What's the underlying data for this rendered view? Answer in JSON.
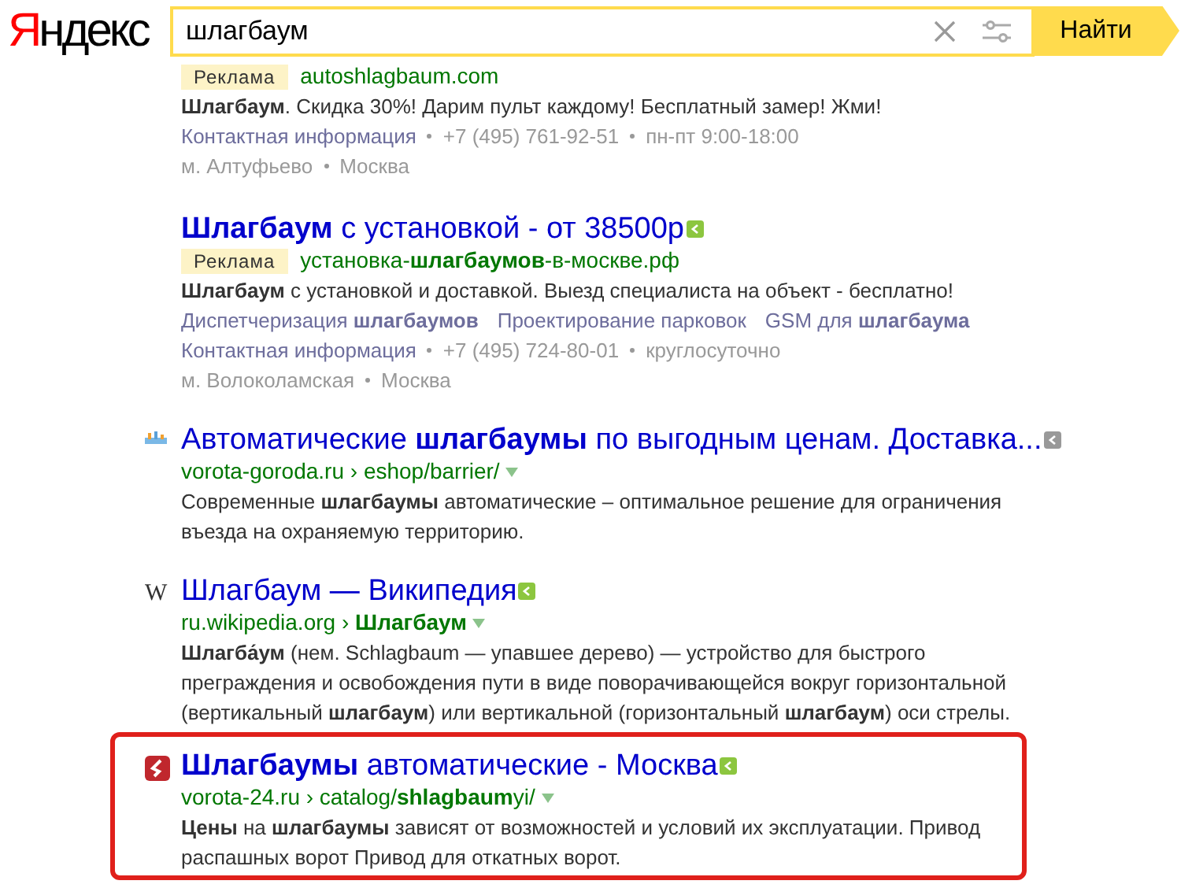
{
  "header": {
    "logo": "Яндекс",
    "query": "шлагбаум",
    "search_button": "Найти"
  },
  "results": [
    {
      "kind": "ad",
      "badge": "Реклама",
      "url": "autoshlagbaum.com",
      "text": "**Шлагбаум**. Скидка 30%! Дарим пульт каждому! Бесплатный замер! Жми!",
      "contacts": [
        "Контактная информация",
        "+7 (495) 761-92-51",
        "пн-пт 9:00-18:00"
      ],
      "metro": [
        "м. Алтуфьево",
        "Москва"
      ],
      "highlighted": false
    },
    {
      "kind": "ad",
      "title": "**Шлагбаум** с установкой - от 38500р",
      "title_mark": {
        "color": "#8cc63f"
      },
      "badge": "Реклама",
      "url": "установка-**шлагбаумов**-в-москве.рф",
      "text": "**Шлагбаум** с установкой и доставкой. Выезд специалиста на объект - бесплатно!",
      "sitelinks": [
        "Диспетчеризация **шлагбаумов**",
        "Проектирование парковок",
        "GSM для **шлагбаума**"
      ],
      "contacts": [
        "Контактная информация",
        "+7 (495) 724-80-01",
        "круглосуточно"
      ],
      "metro": [
        "м. Волоколамская",
        "Москва"
      ],
      "highlighted": false
    },
    {
      "kind": "organic",
      "favicon": {
        "kind": "bars"
      },
      "title": "Автоматические **шлагбаумы** по выгодным ценам. Доставка...",
      "title_mark": {
        "color": "#999999"
      },
      "url": "vorota-goroda.ru › eshop/barrier/",
      "text": "Современные **шлагбаумы** автоматические – оптимальное решение для ограничения въезда на охраняемую территорию.",
      "highlighted": false
    },
    {
      "kind": "organic",
      "favicon": {
        "kind": "letter",
        "text": "W"
      },
      "title": "Шлагбаум — Википедия",
      "title_mark": {
        "color": "#8cc63f"
      },
      "url": "ru.wikipedia.org › **Шлагбаум**",
      "text": "**Шлагба́ум** (нем. Schlagbaum — упавшее дерево) — устройство для быстрого преграждения и освобождения пути в виде поворачивающейся вокруг горизонтальной (вертикальный **шлагбаум**) или вертикальной (горизонтальный **шлагбаум**) оси стрелы.",
      "highlighted": false
    },
    {
      "kind": "organic",
      "favicon": {
        "kind": "s-logo"
      },
      "title": "**Шлагбаумы** автоматические - Москва",
      "title_mark": {
        "color": "#8cc63f"
      },
      "url": "vorota-24.ru › catalog/**shlagbaum**yi/",
      "text": "**Цены** на **шлагбаумы** зависят от возможностей и условий их эксплуатации. Привод распашных ворот Привод для откатных ворот.",
      "highlighted": true
    }
  ]
}
